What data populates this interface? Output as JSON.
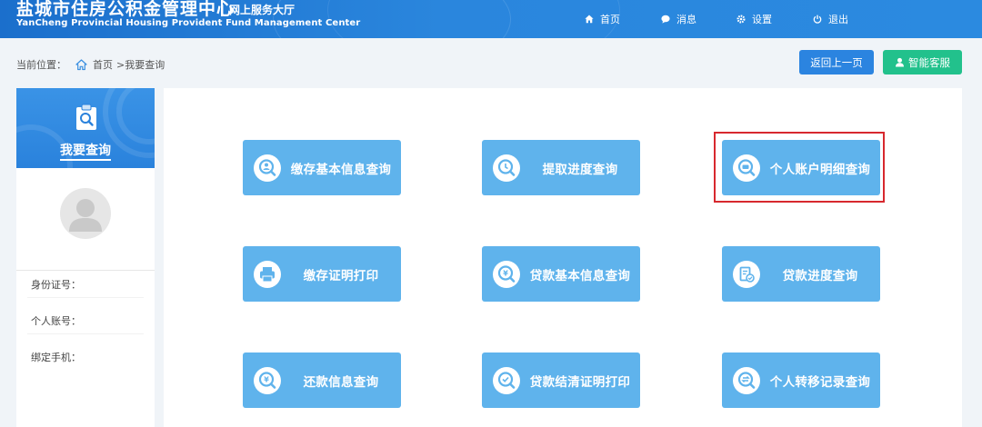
{
  "header": {
    "title": "盐城市住房公积金管理中心",
    "subtitle": "网上服务大厅",
    "title_en": "YanCheng Provincial Housing Provident Fund Management Center",
    "nav": [
      {
        "label": "首页",
        "icon": "home-icon"
      },
      {
        "label": "消息",
        "icon": "message-icon"
      },
      {
        "label": "设置",
        "icon": "gear-icon"
      },
      {
        "label": "退出",
        "icon": "power-icon"
      }
    ]
  },
  "breadcrumb": {
    "prefix": "当前位置：",
    "home": "首页",
    "current": ">我要查询"
  },
  "actions": {
    "back": "返回上一页",
    "service": "智能客服"
  },
  "sidebar": {
    "title": "我要查询",
    "fields": [
      {
        "label": "身份证号："
      },
      {
        "label": "个人账号："
      },
      {
        "label": "绑定手机："
      }
    ]
  },
  "queries": [
    {
      "label": "缴存基本信息查询",
      "icon": "search-person-icon"
    },
    {
      "label": "提取进度查询",
      "icon": "progress-search-icon"
    },
    {
      "label": "个人账户明细查询",
      "icon": "account-search-icon",
      "highlighted": true
    },
    {
      "label": "缴存证明打印",
      "icon": "printer-icon"
    },
    {
      "label": "贷款基本信息查询",
      "icon": "loan-search-icon"
    },
    {
      "label": "贷款进度查询",
      "icon": "document-check-icon"
    },
    {
      "label": "还款信息查询",
      "icon": "repay-search-icon"
    },
    {
      "label": "贷款结清证明打印",
      "icon": "settle-search-icon"
    },
    {
      "label": "个人转移记录查询",
      "icon": "transfer-search-icon"
    }
  ],
  "colors": {
    "header": "#2a86dd",
    "query_button": "#5fb3ec",
    "back_button": "#2b84e0",
    "service_button": "#22c18c",
    "highlight": "#d7282e"
  }
}
